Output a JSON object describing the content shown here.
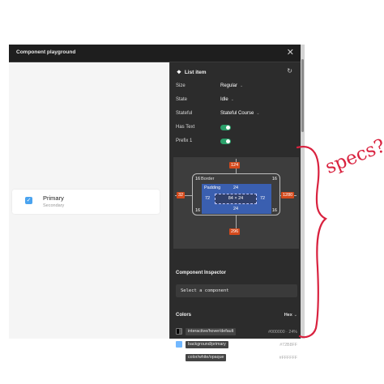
{
  "window": {
    "title": "Component playground",
    "close_glyph": "✕"
  },
  "preview": {
    "item": {
      "primary": "Primary",
      "secondary": "Secondary",
      "checked": true
    }
  },
  "panel": {
    "header": {
      "title": "List item",
      "icon": "component-diamond-icon",
      "refresh_icon": "refresh-icon"
    },
    "properties": {
      "size": {
        "label": "Size",
        "value": "Regular"
      },
      "state": {
        "label": "State",
        "value": "Idle"
      },
      "stateful": {
        "label": "Stateful",
        "value": "Stateful Course"
      },
      "has_text": {
        "label": "Has Text",
        "on": true
      },
      "prefix": {
        "label": "Prefix 1",
        "on": true
      }
    },
    "specs": {
      "top": "124",
      "bottom": "296",
      "left": "32",
      "right": "1280",
      "border_label": "Border",
      "border_top_left": "16",
      "border_top_right": "16",
      "border_bottom_left": "16",
      "border_bottom_right": "16",
      "padding_label": "Padding",
      "padding_top": "24",
      "padding_bottom": "24",
      "padding_left": "72",
      "padding_right": "72",
      "content": "84 × 24"
    },
    "inspector": {
      "title": "Component Inspector",
      "placeholder": "Select a component"
    },
    "colors": {
      "title": "Colors",
      "format": "Hex",
      "items": [
        {
          "token": "interactive/hover/default",
          "value": "#000000 · 24%",
          "swatch": "#000000"
        },
        {
          "token": "background/primary",
          "value": "#72B8FF",
          "swatch": "#72B8FF"
        },
        {
          "token": "color/white/opaque",
          "value": "#FFFFFF",
          "swatch": "#FFFFFF"
        }
      ]
    }
  },
  "annotation": {
    "text": "specs?",
    "color": "#d9223f"
  }
}
